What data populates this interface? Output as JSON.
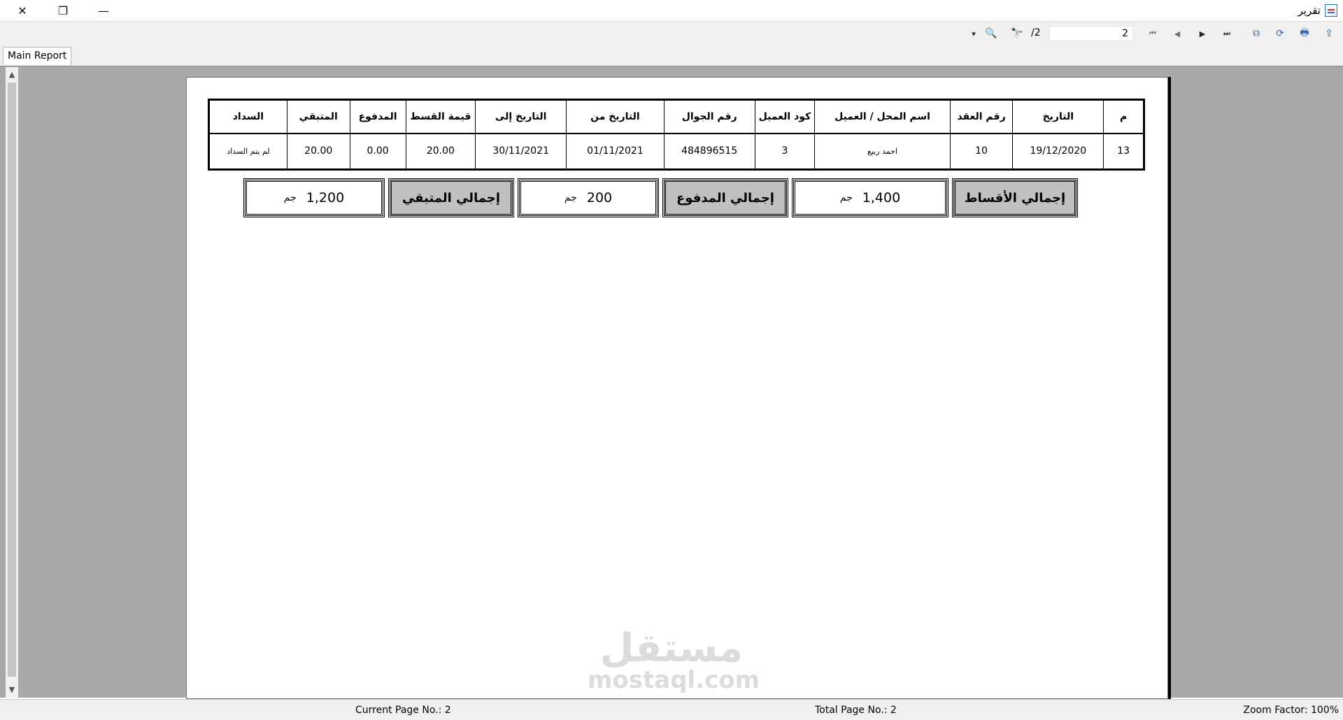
{
  "window": {
    "title": "تقرير",
    "app_icon": "report-icon",
    "close_glyph": "✕",
    "maximize_glyph": "❐",
    "minimize_glyph": "—"
  },
  "toolbar": {
    "dropdown_glyph": "▾",
    "zoom_icon": "🔍",
    "find_icon": "🔭",
    "page_total": "/2",
    "page_current": "2",
    "first_glyph": "⏮",
    "prev_glyph": "◀",
    "next_glyph": "▶",
    "last_glyph": "⏭",
    "copy_icon": "⧉",
    "refresh_icon": "⟳",
    "print_icon": "🖶",
    "export_icon": "⇪"
  },
  "tabs": [
    {
      "label": "Main Report"
    }
  ],
  "report": {
    "columns": [
      "م",
      "التاريخ",
      "رقم العقد",
      "اسم المحل / العميل",
      "كود العميل",
      "رقم الجوال",
      "التاريخ من",
      "التاريخ إلى",
      "قيمة القسط",
      "المدفوع",
      "المتبقي",
      "السداد"
    ],
    "rows": [
      [
        "13",
        "19/12/2020",
        "10",
        "احمد ربيع",
        "3",
        "484896515",
        "01/11/2021",
        "30/11/2021",
        "20.00",
        "0.00",
        "20.00",
        "لم يتم السداد"
      ]
    ],
    "totals": {
      "installments_label": "إجمالي الأقساط",
      "installments_value": "1,400",
      "paid_label": "إجمالي المدفوع",
      "paid_value": "200",
      "remaining_label": "إجمالي المتبقي",
      "remaining_value": "1,200",
      "currency": "جم"
    }
  },
  "watermark": {
    "arabic": "مستقل",
    "latin": "mostaql.com"
  },
  "status": {
    "current_page": "Current Page No.: 2",
    "total_pages": "Total Page No.: 2",
    "zoom": "Zoom Factor: 100%"
  },
  "scroll": {
    "up_glyph": "▲",
    "down_glyph": "▼"
  }
}
